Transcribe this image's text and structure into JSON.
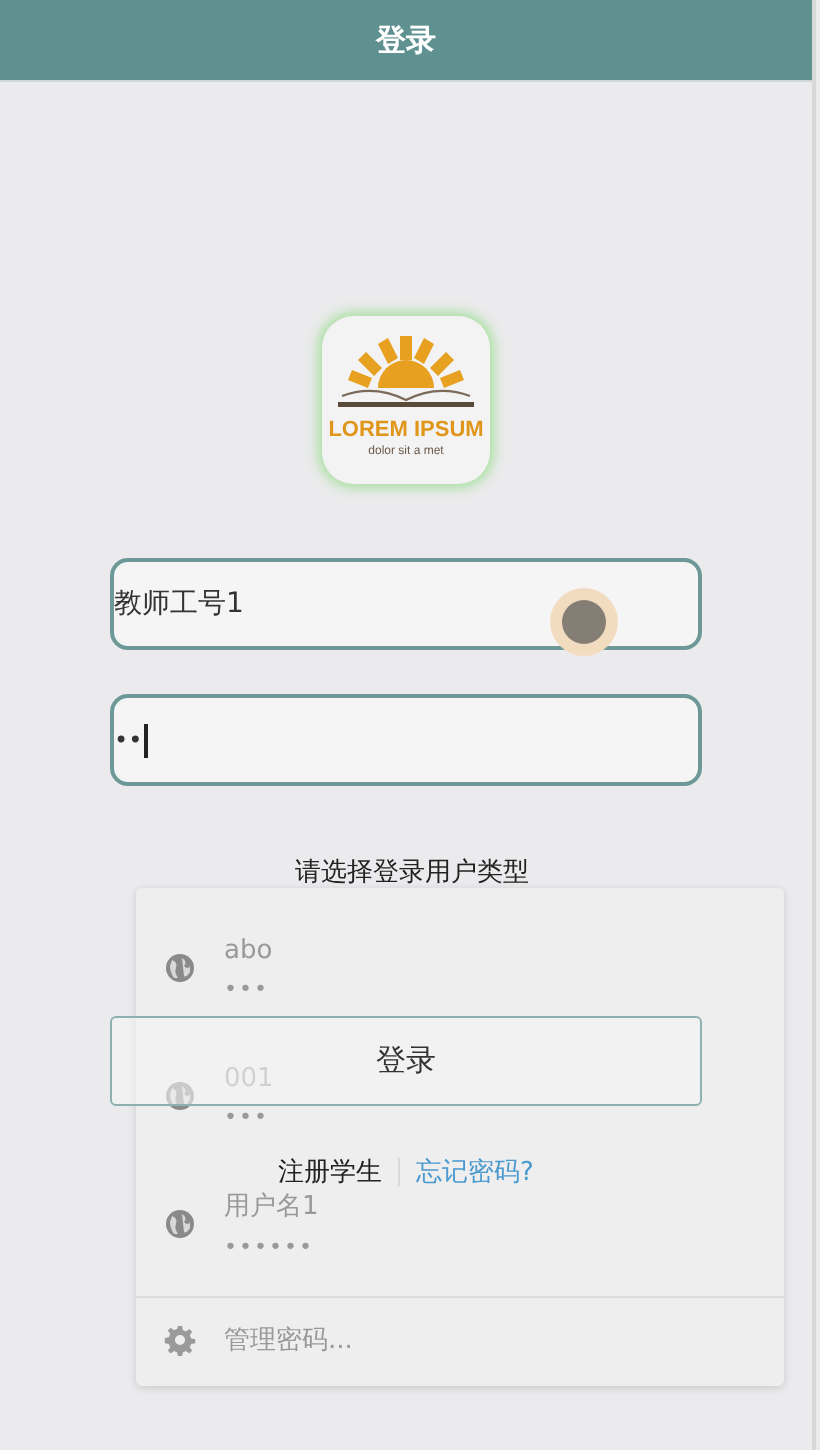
{
  "header": {
    "title": "登录"
  },
  "logo": {
    "title": "LOREM IPSUM",
    "subtitle": "dolor sit a met"
  },
  "username_field": {
    "value": "教师工号1"
  },
  "password_field": {
    "value": "••"
  },
  "user_type_prompt": "请选择登录用户类型",
  "login_button": "登录",
  "links": [
    {
      "label": "注册学生",
      "kind": "plain"
    },
    {
      "label": "忘记密码?",
      "kind": "link"
    }
  ],
  "autofill_popup": {
    "entries": [
      {
        "username": "abo",
        "password": "•••"
      },
      {
        "username": "001",
        "password": "•••"
      },
      {
        "username": "用户名1",
        "password": "••••••"
      }
    ],
    "manage": "管理密码..."
  }
}
